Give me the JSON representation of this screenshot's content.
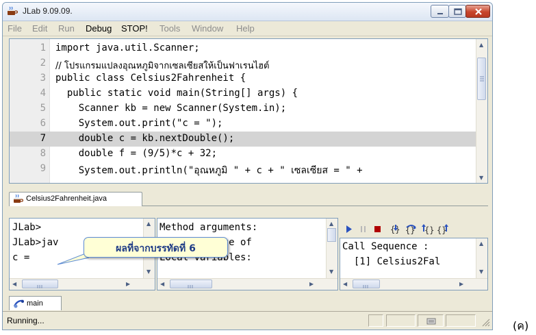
{
  "window": {
    "title": "JLab 9.09.09."
  },
  "menu": [
    {
      "label": "File",
      "enabled": false
    },
    {
      "label": "Edit",
      "enabled": false
    },
    {
      "label": "Run",
      "enabled": false
    },
    {
      "label": "Debug",
      "enabled": true
    },
    {
      "label": "STOP!",
      "enabled": true
    },
    {
      "label": "Tools",
      "enabled": false
    },
    {
      "label": "Window",
      "enabled": false
    },
    {
      "label": "Help",
      "enabled": false
    }
  ],
  "editor": {
    "active_line": 7,
    "lines": [
      {
        "num": "1",
        "text": "import java.util.Scanner;"
      },
      {
        "num": "2",
        "text": "// โปรแกรมแปลงอุณหภูมิจากเซลเซียสให้เป็นฟาเรนไฮต์"
      },
      {
        "num": "3",
        "text": "public class Celsius2Fahrenheit {"
      },
      {
        "num": "4",
        "text": "  public static void main(String[] args) {"
      },
      {
        "num": "5",
        "text": "    Scanner kb = new Scanner(System.in);"
      },
      {
        "num": "6",
        "text": "    System.out.print(\"c = \");"
      },
      {
        "num": "7",
        "text": "    double c = kb.nextDouble();"
      },
      {
        "num": "8",
        "text": "    double f = (9/5)*c + 32;"
      },
      {
        "num": "9",
        "text": "    System.out.println(\"อุณหภูมิ \" + c + \" เซลเซียส = \" +"
      }
    ]
  },
  "file_tab": {
    "label": "Celsius2Fahrenheit.java"
  },
  "console": {
    "lines": [
      "JLab>",
      "JLab>jav",
      "c = "
    ]
  },
  "variables": {
    "lines": [
      "Method arguments:",
      "     instance of",
      "Local variables:"
    ]
  },
  "callstack": {
    "lines": [
      "Call Sequence :",
      "  [1] Celsius2Fal"
    ]
  },
  "tooltip": {
    "text": "ผลที่จากบรรทัดที่ 6"
  },
  "bottom_tab": {
    "label": "main"
  },
  "status": {
    "text": "Running..."
  },
  "outside_label": "(ค)",
  "icons": [
    "coffee-cup-icon",
    "run-icon",
    "pause-icon",
    "stop-icon",
    "step-into-icon",
    "step-over-icon",
    "step-out-icon",
    "step-return-icon"
  ],
  "colors": {
    "active_line": "#d4d4d4",
    "tooltip_bg": "#ffffd6",
    "stop": "#b00000"
  }
}
